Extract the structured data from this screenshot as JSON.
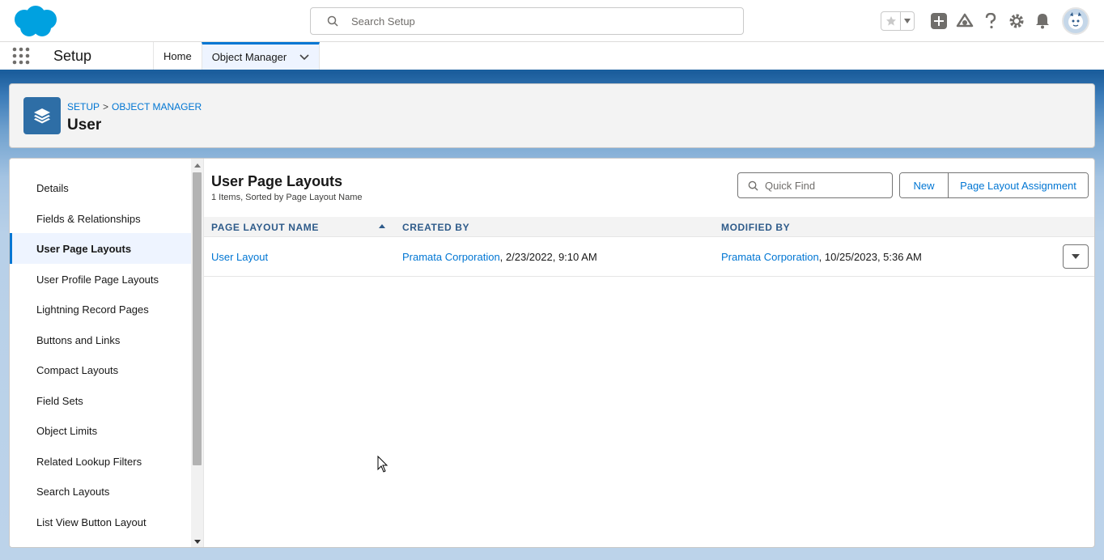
{
  "header": {
    "search_placeholder": "Search Setup",
    "icons": [
      "salesforce-logo",
      "favorites-star-icon",
      "chevron-down-icon",
      "global-create-icon",
      "trailhead-icon",
      "help-icon",
      "gear-icon",
      "notification-bell-icon",
      "user-avatar"
    ]
  },
  "nav": {
    "app_name": "Setup",
    "items": [
      {
        "label": "Home"
      },
      {
        "label": "Object Manager"
      }
    ]
  },
  "object_header": {
    "breadcrumb": [
      "SETUP",
      "OBJECT MANAGER"
    ],
    "breadcrumb_sep": ">",
    "title": "User"
  },
  "sidebar": {
    "items": [
      {
        "label": "Details"
      },
      {
        "label": "Fields & Relationships"
      },
      {
        "label": "User Page Layouts"
      },
      {
        "label": "User Profile Page Layouts"
      },
      {
        "label": "Lightning Record Pages"
      },
      {
        "label": "Buttons and Links"
      },
      {
        "label": "Compact Layouts"
      },
      {
        "label": "Field Sets"
      },
      {
        "label": "Object Limits"
      },
      {
        "label": "Related Lookup Filters"
      },
      {
        "label": "Search Layouts"
      },
      {
        "label": "List View Button Layout"
      }
    ],
    "active_index": 2
  },
  "content": {
    "title": "User Page Layouts",
    "subtitle": "1 Items, Sorted by Page Layout Name",
    "quick_find_placeholder": "Quick Find",
    "new_label": "New",
    "assignment_label": "Page Layout Assignment",
    "columns": [
      "PAGE LAYOUT NAME",
      "CREATED BY",
      "MODIFIED BY"
    ],
    "rows": [
      {
        "name": "User Layout",
        "created_by": "Pramata Corporation",
        "created_at": ", 2/23/2022, 9:10 AM",
        "modified_by": "Pramata Corporation",
        "modified_at": ", 10/25/2023, 5:36 AM"
      }
    ]
  },
  "colors": {
    "brand_blue": "#0176d3",
    "header_band": "#1b5f9e",
    "object_icon_bg": "#2e6ea6"
  }
}
